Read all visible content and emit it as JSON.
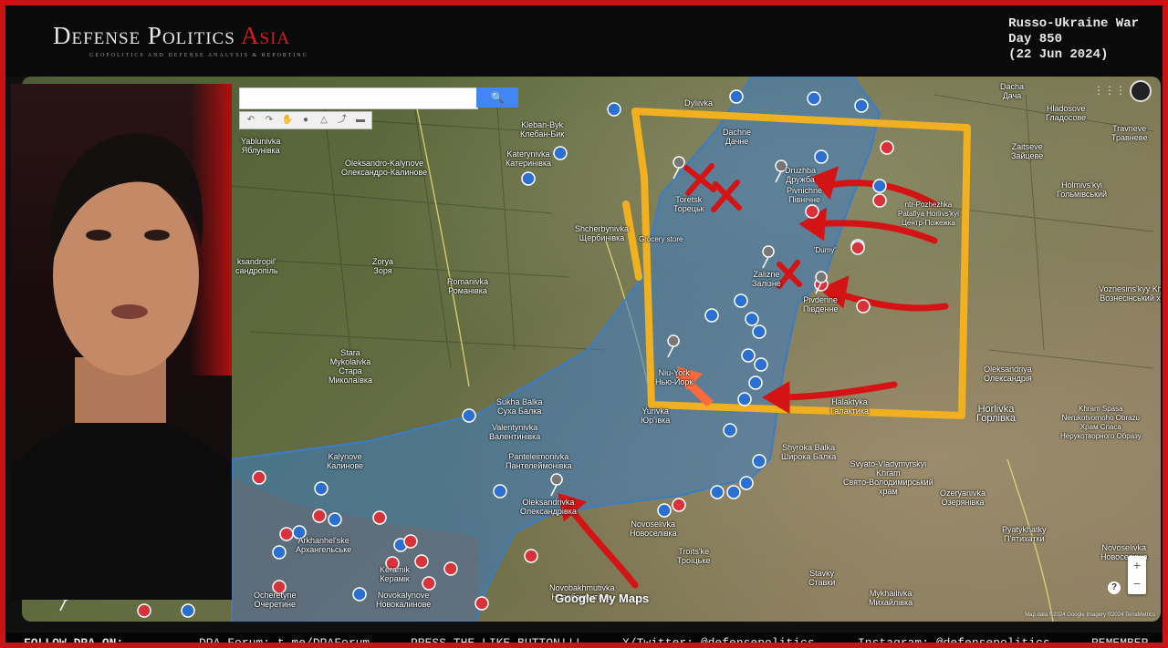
{
  "branding": {
    "name_main": "Defense Politics",
    "name_accent": "Asia",
    "tagline": "GEOPOLITICS AND DEFENSE ANALYSIS & REPORTING"
  },
  "war_overlay": {
    "line1": "Russo-Ukraine War",
    "line2": "Day 850",
    "line3": "(22 Jun 2024)"
  },
  "map": {
    "search_button_icon": "search-icon",
    "attribution": "Map data ©2024 Google Imagery ©2024 TerraMetrics",
    "logo": "Google My Maps",
    "zoom_in": "+",
    "zoom_out": "−",
    "help": "?",
    "tools": [
      "undo-icon",
      "redo-icon",
      "hand-icon",
      "marker-icon",
      "polygon-icon",
      "route-icon",
      "ruler-icon"
    ],
    "places": [
      {
        "id": "dyliivka",
        "text": "Dyliivka"
      },
      {
        "id": "kleban-byk",
        "text": "Kleban-Byk\nКлебан-Бик"
      },
      {
        "id": "yablunivka",
        "text": "Yablunivka\nЯблунівка"
      },
      {
        "id": "oleksandro-kalynove",
        "text": "Oleksandro-Kalynove\nОлександро-Калинове"
      },
      {
        "id": "katerynivka",
        "text": "Katerynivka\nКатеринівка"
      },
      {
        "id": "shcherbynivka",
        "text": "Shcherbynivka\nЩербинівка"
      },
      {
        "id": "zorya",
        "text": "Zorya\nЗоря"
      },
      {
        "id": "romanivka",
        "text": "Romanivka\nРоманівка"
      },
      {
        "id": "oleksandropil",
        "text": "ksandropil'\nсандропіль"
      },
      {
        "id": "stara-mykolaivka",
        "text": "Stara\nMykolaivka\nСтара\nМиколаївка"
      },
      {
        "id": "sukha-balka",
        "text": "Sukha Balka\nСуха Балка"
      },
      {
        "id": "valentynivka",
        "text": "Valentynivka\nВалентинівка"
      },
      {
        "id": "panteleimonivka",
        "text": "Panteleimonivka\nПантелеймонівка"
      },
      {
        "id": "kalynove",
        "text": "Kalynove\nКалинове"
      },
      {
        "id": "oleksandrivka",
        "text": "Oleksandrivka\nОлександрівка"
      },
      {
        "id": "novoselivka",
        "text": "Novoselivka\nНовоселівка"
      },
      {
        "id": "troitske",
        "text": "Troïts'ke\nТроїцьке"
      },
      {
        "id": "novobakhmutivka",
        "text": "Novobakhmutivka\nНовобахмутівка"
      },
      {
        "id": "novokalynove",
        "text": "Novokalynove\nНовокалинове"
      },
      {
        "id": "keramik",
        "text": "Keramik\nКерамік"
      },
      {
        "id": "ocheretyne",
        "text": "Ocheretyne\nОчеретине"
      },
      {
        "id": "arkhanhelske",
        "text": "Arkhanhel'ske\nАрхангельське"
      },
      {
        "id": "dachne",
        "text": "Dachne\nДачне"
      },
      {
        "id": "druzhba",
        "text": "Druzhba\nДружба"
      },
      {
        "id": "pivnichne",
        "text": "Pivnichne\nПівнічне"
      },
      {
        "id": "toretsk",
        "text": "Toretsk\nТорецьк"
      },
      {
        "id": "zalizne",
        "text": "Zalizne\nЗалізне"
      },
      {
        "id": "pivdenne",
        "text": "Pivdenne\nПівденне"
      },
      {
        "id": "yurivka",
        "text": "Yurivka\nЮр'ївка"
      },
      {
        "id": "niu-york",
        "text": "Niu-York\nНью-Йорк"
      },
      {
        "id": "halaktyka",
        "text": "Halaktyka\nГалактика"
      },
      {
        "id": "shyroka-balka",
        "text": "Shyroka Balka\nШирока Балка"
      },
      {
        "id": "svyato-vladymyrskyi",
        "text": "Svyato-Vladymyrskyi\nKhram\nСвято-Володимирський\nхрам"
      },
      {
        "id": "dacha",
        "text": "Dacha\nДача"
      },
      {
        "id": "hladosove",
        "text": "Hladosove\nГладосове"
      },
      {
        "id": "travneve",
        "text": "Travneve\nТравневе"
      },
      {
        "id": "zaitseve",
        "text": "Zaitseve\nЗайцеве"
      },
      {
        "id": "holmivskyi",
        "text": "Holmivs'kyi\nГольмівський"
      },
      {
        "id": "voznesinskyi",
        "text": "Voznesins'kyy Khram\nВознесінський храм"
      },
      {
        "id": "oleksandriya",
        "text": "Oleksandriya\nОлександрія"
      },
      {
        "id": "horlivka",
        "text": "Horlivka\nГорлівка"
      },
      {
        "id": "khram-spasa",
        "text": "Khram Spasa\nNerukotvornoho Obrazu\nХрам Спаса\nНерукотворного Образу"
      },
      {
        "id": "ozeryanivka",
        "text": "Ozeryanivka\nОзерянівка"
      },
      {
        "id": "pyatykhatky",
        "text": "Pyatykhatky\nП'ятихатки"
      },
      {
        "id": "stavky",
        "text": "Stavky\nСтавки"
      },
      {
        "id": "mykhailivka",
        "text": "Mykhailivka\nМихайлівка"
      },
      {
        "id": "novoselivka-2",
        "text": "Novoselivka\nНовоселівка"
      },
      {
        "id": "zaitseve-region",
        "text": "ntr-Pozhezhka\nPatafiya Horlivs'kyi\nЦентр-Пожежка"
      },
      {
        "id": "dumy",
        "text": "'Dumy'"
      },
      {
        "id": "grocery",
        "text": "Grocery store"
      }
    ]
  },
  "ticker": {
    "follow": "FOLLOW DPA ON:",
    "forum": "DPA Forum: t.me/DPAForum",
    "like": "PRESS THE LIKE BUTTON!!!",
    "twitter": "X/Twitter: @defensepolitics",
    "instagram": "Instagram: @defensepolitics",
    "remember": "REMEMBER"
  },
  "colors": {
    "frame": "#c81414",
    "ukraine_zone": "#3b7cc4",
    "highlight_box": "#f0b020",
    "attack_arrows": "#d41414"
  }
}
